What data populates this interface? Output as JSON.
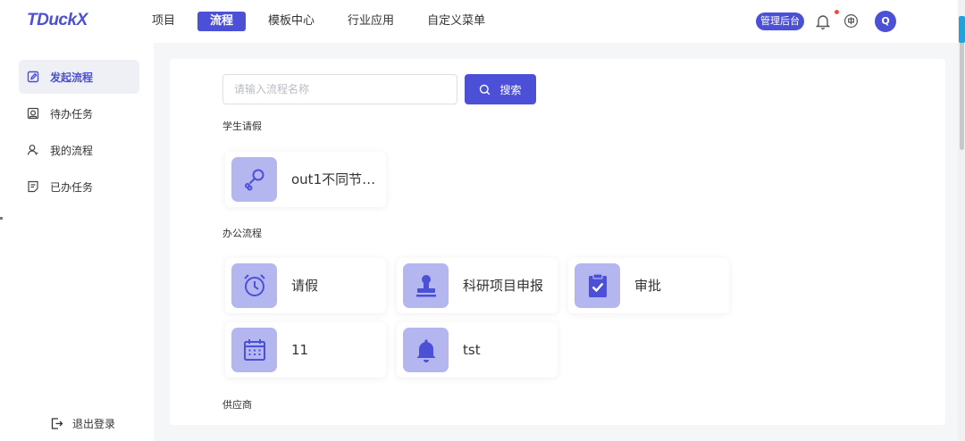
{
  "header": {
    "logo": "TDuckX",
    "nav": [
      {
        "label": "项目",
        "active": false
      },
      {
        "label": "流程",
        "active": true
      },
      {
        "label": "模板中心",
        "active": false
      },
      {
        "label": "行业应用",
        "active": false
      },
      {
        "label": "自定义菜单",
        "active": false
      }
    ],
    "admin_label": "管理后台",
    "avatar_letter": "Q"
  },
  "sidebar": {
    "items": [
      {
        "label": "发起流程",
        "icon": "edit-icon",
        "active": true
      },
      {
        "label": "待办任务",
        "icon": "todo-icon",
        "active": false
      },
      {
        "label": "我的流程",
        "icon": "user-icon",
        "active": false
      },
      {
        "label": "已办任务",
        "icon": "done-doc-icon",
        "active": false
      }
    ],
    "logout_label": "退出登录"
  },
  "search": {
    "placeholder": "请输入流程名称",
    "value": "",
    "button_label": "搜索"
  },
  "groups": [
    {
      "title": "学生请假",
      "cards": [
        {
          "label": "out1不同节…",
          "icon": "drumstick-icon"
        }
      ]
    },
    {
      "title": "办公流程",
      "cards": [
        {
          "label": "请假",
          "icon": "alarm-clock-icon"
        },
        {
          "label": "科研项目申报",
          "icon": "stamp-icon"
        },
        {
          "label": "审批",
          "icon": "clipboard-check-icon"
        },
        {
          "label": "11",
          "icon": "calendar-icon"
        },
        {
          "label": "tst",
          "icon": "bell-icon"
        }
      ]
    },
    {
      "title": "供应商",
      "cards": []
    }
  ],
  "colors": {
    "accent": "#4b50d6",
    "icon_bg": "#b4b6f0",
    "icon_fg": "#4b50d6"
  }
}
